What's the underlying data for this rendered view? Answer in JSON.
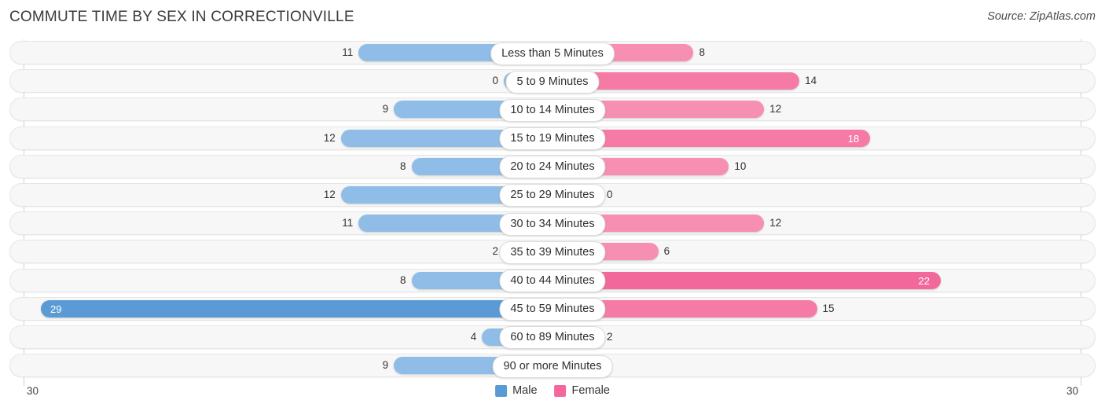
{
  "header": {
    "title": "COMMUTE TIME BY SEX IN CORRECTIONVILLE",
    "source": "Source: ZipAtlas.com"
  },
  "legend": {
    "items": [
      {
        "label": "Male",
        "color": "#5b9bd5"
      },
      {
        "label": "Female",
        "color": "#f2689b"
      }
    ]
  },
  "axis": {
    "left_tick": "30",
    "right_tick": "30",
    "max": 30
  },
  "colors": {
    "male_normal": "#8fbde7",
    "male_max": "#5b9bd5",
    "female_normal": "#f78fb3",
    "female_max": "#f2689b",
    "female_mid": "#f57ba6",
    "track": "#f7f7f7",
    "track_border": "#e6e6e6"
  },
  "chart_data": {
    "type": "bar",
    "title": "COMMUTE TIME BY SEX IN CORRECTIONVILLE",
    "subtitle": "Source: ZipAtlas.com",
    "orientation": "horizontal-diverging",
    "xlabel": "",
    "ylabel": "",
    "xlim": [
      30,
      30
    ],
    "grid": false,
    "legend_position": "bottom-center",
    "categories": [
      "Less than 5 Minutes",
      "5 to 9 Minutes",
      "10 to 14 Minutes",
      "15 to 19 Minutes",
      "20 to 24 Minutes",
      "25 to 29 Minutes",
      "30 to 34 Minutes",
      "35 to 39 Minutes",
      "40 to 44 Minutes",
      "45 to 59 Minutes",
      "60 to 89 Minutes",
      "90 or more Minutes"
    ],
    "series": [
      {
        "name": "Male",
        "values": [
          11,
          0,
          9,
          12,
          8,
          12,
          11,
          2,
          8,
          29,
          4,
          9
        ]
      },
      {
        "name": "Female",
        "values": [
          8,
          14,
          12,
          18,
          10,
          0,
          12,
          6,
          22,
          15,
          2,
          0
        ]
      }
    ]
  }
}
